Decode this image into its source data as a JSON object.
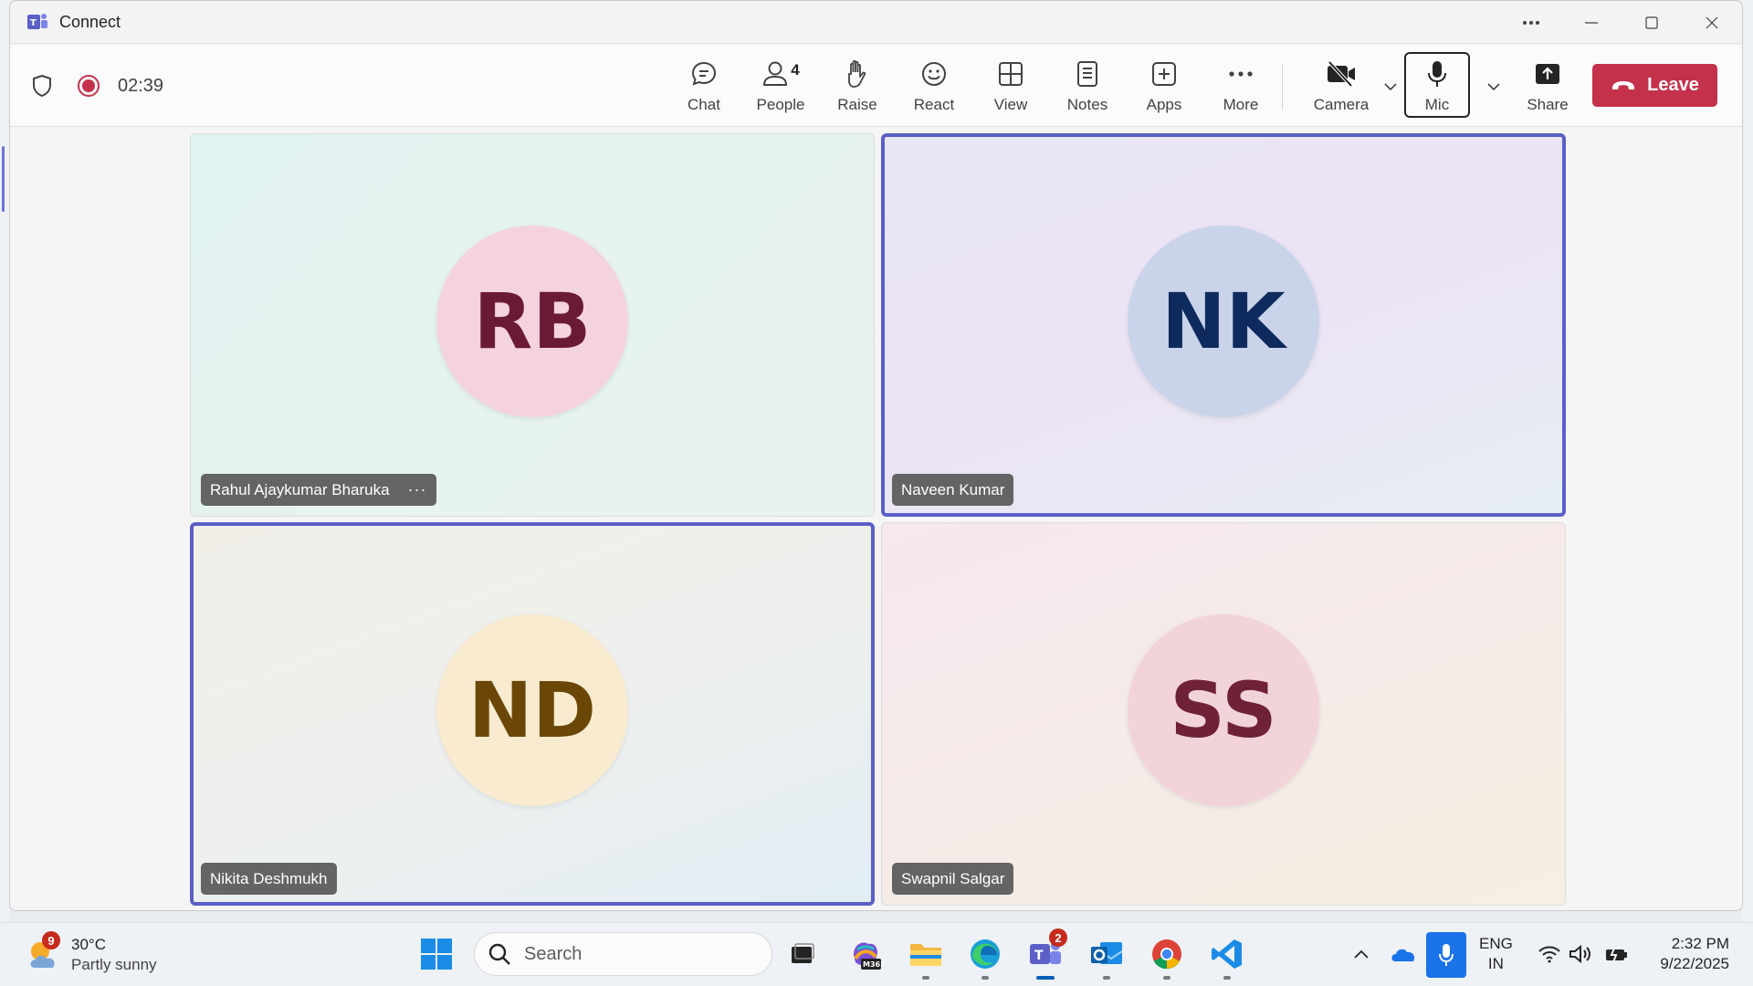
{
  "window": {
    "title": "Connect"
  },
  "meeting": {
    "timer": "02:39"
  },
  "toolbar": {
    "chat": "Chat",
    "people": "People",
    "people_count": "4",
    "raise": "Raise",
    "react": "React",
    "view": "View",
    "notes": "Notes",
    "apps": "Apps",
    "more": "More",
    "camera": "Camera",
    "mic": "Mic",
    "share": "Share",
    "leave": "Leave"
  },
  "participants": [
    {
      "initials": "RB",
      "name": "Rahul Ajaykumar Bharuka",
      "more": "···",
      "speaking": false
    },
    {
      "initials": "NK",
      "name": "Naveen Kumar",
      "speaking": true
    },
    {
      "initials": "ND",
      "name": "Nikita Deshmukh",
      "speaking": true
    },
    {
      "initials": "SS",
      "name": "Swapnil Salgar",
      "speaking": false
    }
  ],
  "taskbar": {
    "weather": {
      "temp": "30°C",
      "desc": "Partly sunny",
      "badge": "9"
    },
    "search_placeholder": "Search",
    "teams_badge": "2",
    "copilot_label": "M365",
    "lang_line1": "ENG",
    "lang_line2": "IN",
    "time": "2:32 PM",
    "date": "9/22/2025"
  },
  "colors": {
    "accent": "#5b5fc7",
    "leave": "#c4314b",
    "record": "#c4314b"
  }
}
